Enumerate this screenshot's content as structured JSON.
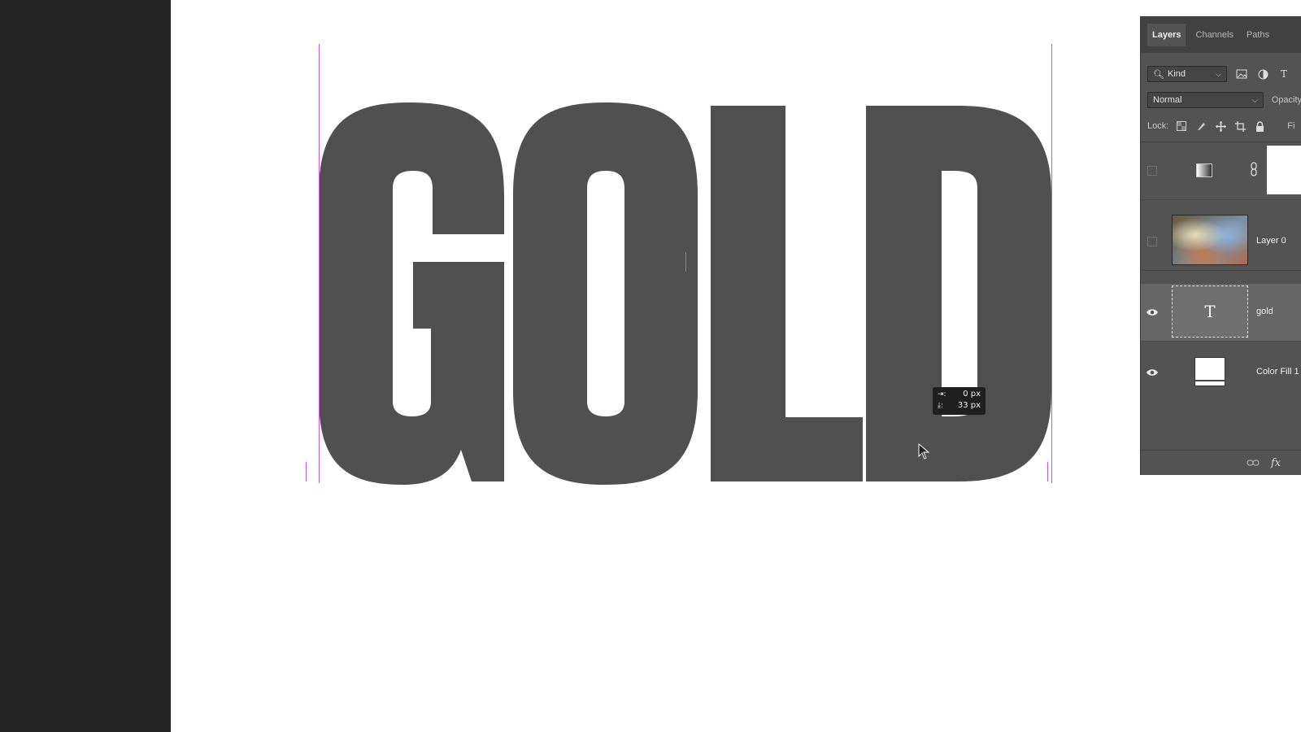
{
  "canvas": {
    "text_layer_content": "GOLD",
    "text_color": "#505050",
    "guide_color": "#c75bd6"
  },
  "measure_tooltip": {
    "horizontal_label": "0 px",
    "vertical_label": "33 px"
  },
  "layers_panel": {
    "tabs": [
      {
        "label": "Layers",
        "active": true
      },
      {
        "label": "Channels",
        "active": false
      },
      {
        "label": "Paths",
        "active": false
      }
    ],
    "filter": {
      "label": "Kind"
    },
    "blend_mode": "Normal",
    "opacity_label": "Opacity",
    "lock_label": "Lock:",
    "fill_label": "Fi",
    "layers": [
      {
        "name": "",
        "type": "adjustment",
        "visible": false,
        "selected": false
      },
      {
        "name": "Layer 0",
        "type": "image",
        "visible": false,
        "selected": false
      },
      {
        "name": "gold",
        "type": "text",
        "visible": true,
        "selected": true
      },
      {
        "name": "Color Fill 1",
        "type": "fill",
        "visible": true,
        "selected": false
      }
    ]
  }
}
